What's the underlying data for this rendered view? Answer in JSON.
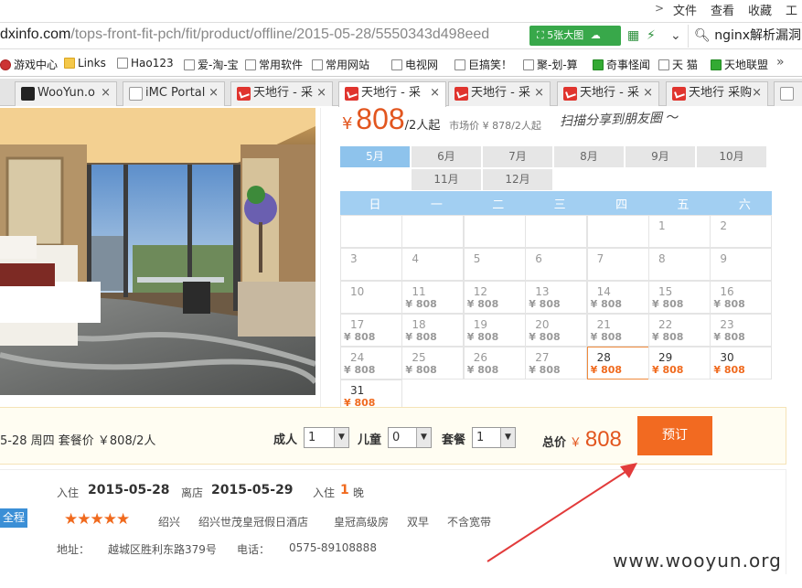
{
  "menubar": {
    "items": [
      "文件",
      "查看",
      "收藏",
      "工具"
    ]
  },
  "address": {
    "host": "dxinfo.com",
    "path": "/tops-front-fit-pch/fit/product/offline/2015-05-28/5550343d498eed",
    "green_button": "5张大图",
    "search": "nginx解析漏洞"
  },
  "bookmarks": [
    {
      "label": "游戏中心",
      "icon": "game"
    },
    {
      "label": "Links",
      "icon": "folder"
    },
    {
      "label": "Hao123",
      "icon": "page"
    },
    {
      "label": "爱-淘-宝",
      "icon": "page"
    },
    {
      "label": "常用软件",
      "icon": "page"
    },
    {
      "label": "常用网站",
      "icon": "page"
    },
    {
      "label": "电视网",
      "icon": "page"
    },
    {
      "label": "巨搞笑！",
      "icon": "page"
    },
    {
      "label": "聚-划-算",
      "icon": "page"
    },
    {
      "label": "奇事怪闻",
      "icon": "green"
    },
    {
      "label": "天 猫",
      "icon": "page"
    },
    {
      "label": "天地联盟",
      "icon": "green"
    }
  ],
  "tabs": [
    {
      "label": "WooYun.o",
      "icon": "dark"
    },
    {
      "label": "iMC Portal",
      "icon": "page"
    },
    {
      "label": "天地行 - 采",
      "icon": "red"
    },
    {
      "label": "天地行 - 采",
      "icon": "red",
      "active": true
    },
    {
      "label": "天地行 - 采",
      "icon": "red"
    },
    {
      "label": "天地行 - 采",
      "icon": "red"
    },
    {
      "label": "天地行 采购",
      "icon": "red"
    }
  ],
  "product": {
    "price": "808",
    "currency": "¥",
    "per": "/2人起",
    "market": "市场价 ¥ 878/2人起",
    "scan_text": "扫描分享到朋友圈"
  },
  "months": [
    "5月",
    "6月",
    "7月",
    "8月",
    "9月",
    "10月",
    "11月",
    "12月"
  ],
  "weekdays": [
    "日",
    "一",
    "二",
    "三",
    "四",
    "五",
    "六"
  ],
  "calendar": [
    [
      null,
      null,
      null,
      null,
      null,
      {
        "d": "1"
      },
      {
        "d": "2"
      }
    ],
    [
      {
        "d": "3"
      },
      {
        "d": "4"
      },
      {
        "d": "5"
      },
      {
        "d": "6"
      },
      {
        "d": "7"
      },
      {
        "d": "8"
      },
      {
        "d": "9"
      }
    ],
    [
      {
        "d": "10"
      },
      {
        "d": "11",
        "p": "¥ 808"
      },
      {
        "d": "12",
        "p": "¥ 808"
      },
      {
        "d": "13",
        "p": "¥ 808"
      },
      {
        "d": "14",
        "p": "¥ 808"
      },
      {
        "d": "15",
        "p": "¥ 808"
      },
      {
        "d": "16",
        "p": "¥ 808"
      }
    ],
    [
      {
        "d": "17",
        "p": "¥ 808"
      },
      {
        "d": "18",
        "p": "¥ 808"
      },
      {
        "d": "19",
        "p": "¥ 808"
      },
      {
        "d": "20",
        "p": "¥ 808"
      },
      {
        "d": "21",
        "p": "¥ 808"
      },
      {
        "d": "22",
        "p": "¥ 808"
      },
      {
        "d": "23",
        "p": "¥ 808"
      }
    ],
    [
      {
        "d": "24",
        "p": "¥ 808"
      },
      {
        "d": "25",
        "p": "¥ 808"
      },
      {
        "d": "26",
        "p": "¥ 808"
      },
      {
        "d": "27",
        "p": "¥ 808"
      },
      {
        "d": "28",
        "p": "¥ 808",
        "sel": true
      },
      {
        "d": "29",
        "p": "¥ 808",
        "or": true
      },
      {
        "d": "30",
        "p": "¥ 808",
        "or": true
      }
    ],
    [
      {
        "d": "31",
        "p": "¥ 808",
        "or": true
      }
    ]
  ],
  "order": {
    "summary": "5-28 周四 套餐价 ￥808/2人",
    "adult_label": "成人",
    "adult_value": "1",
    "child_label": "儿童",
    "child_value": "0",
    "package_label": "套餐",
    "package_value": "1",
    "total_label": "总价",
    "total_currency": "￥",
    "total_value": "808",
    "book_button": "预订"
  },
  "info": {
    "checkin_label": "入住",
    "checkin_date": "2015-05-28",
    "checkout_label": "离店",
    "checkout_date": "2015-05-29",
    "stay_label": "入住",
    "nights": "1",
    "nights_unit": "晚",
    "badge": "全程",
    "rating": 4.5,
    "stars": "★★★★★",
    "city": "绍兴",
    "hotel": "绍兴世茂皇冠假日酒店",
    "room": "皇冠高级房",
    "breakfast": "双早",
    "broadband": "不含宽带",
    "address_label": "地址：",
    "address": "越城区胜利东路379号",
    "phone_label": "电话：",
    "phone": "0575-89108888"
  },
  "watermark": "www.wooyun.org",
  "colors": {
    "accent": "#f26a21",
    "calendar_header": "#a2cff2",
    "green": "#38a84a"
  }
}
